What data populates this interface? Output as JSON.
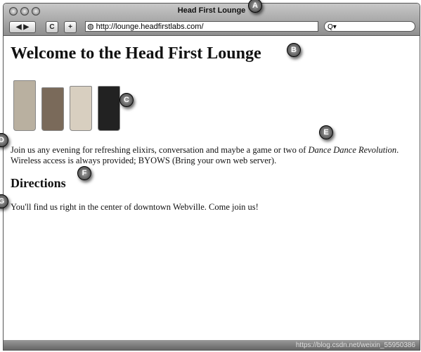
{
  "window": {
    "title": "Head First Lounge"
  },
  "toolbar": {
    "back": "◀",
    "forward": "▶",
    "reload": "C",
    "add": "+",
    "url": "http://lounge.headfirstlabs.com/",
    "search_icon": "Q▾"
  },
  "page": {
    "heading": "Welcome to the Head First Lounge",
    "para1_before": "Join us any evening for refreshing elixirs, conversation and maybe a game or two of ",
    "para1_em": "Dance Dance Revolution",
    "para1_after": ". Wireless access is always provided; BYOWS (Bring your own web server).",
    "directions_heading": "Directions",
    "directions_text": "You'll find us right in the center of downtown Webville. Come join us!",
    "glass_colors": [
      "#b9b0a0",
      "#7a6a5a",
      "#d8cfc0",
      "#222222"
    ]
  },
  "markers": [
    "A",
    "B",
    "C",
    "D",
    "E",
    "F",
    "G"
  ],
  "watermark": "https://blog.csdn.net/weixin_55950386"
}
